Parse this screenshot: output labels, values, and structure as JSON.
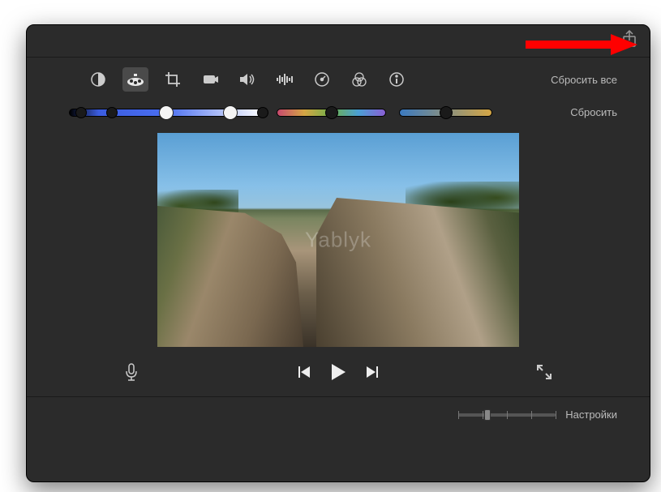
{
  "toolbar": {
    "reset_all_label": "Сбросить все",
    "reset_label": "Сбросить",
    "tools": [
      {
        "name": "color-balance-icon"
      },
      {
        "name": "color-correction-icon"
      },
      {
        "name": "crop-icon"
      },
      {
        "name": "stabilization-icon"
      },
      {
        "name": "volume-icon"
      },
      {
        "name": "noise-reduce-icon"
      },
      {
        "name": "speed-icon"
      },
      {
        "name": "color-filter-icon"
      },
      {
        "name": "info-icon"
      }
    ]
  },
  "sliders": {
    "exposure": {
      "shadows": 6,
      "mid": 50,
      "highlights": 83,
      "hl2": 100
    },
    "saturation": 50,
    "temperature": 50
  },
  "preview": {
    "watermark": "Yablyk"
  },
  "playback": {
    "mic": "mic-icon",
    "prev": "skip-start-icon",
    "play": "play-icon",
    "next": "skip-end-icon",
    "fullscreen": "expand-icon"
  },
  "settings": {
    "label": "Настройки",
    "zoom": 30
  },
  "share": {
    "name": "share-icon"
  }
}
